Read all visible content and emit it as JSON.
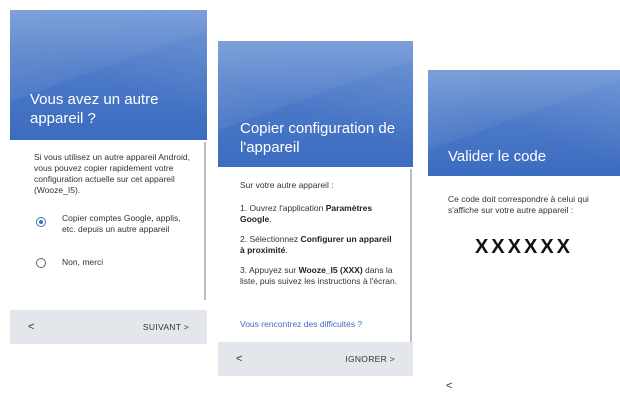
{
  "screen1": {
    "title": "Vous avez un autre appareil ?",
    "description": "Si vous utilisez un autre appareil Android, vous pouvez copier rapidement votre configuration actuelle sur cet appareil (Wooze_I5).",
    "options": [
      {
        "label": "Copier comptes Google, applis, etc. depuis un autre appareil",
        "selected": true
      },
      {
        "label": "Non, merci",
        "selected": false
      }
    ],
    "back_label": "<",
    "next_label": "SUIVANT >"
  },
  "screen2": {
    "title": "Copier configuration de l'appareil",
    "intro": "Sur votre autre appareil :",
    "step1_prefix": "1. Ouvrez l'application ",
    "step1_bold": "Paramètres Google",
    "step1_suffix": ".",
    "step2_prefix": "2. Sélectionnez ",
    "step2_bold": "Configurer un appareil à proximité",
    "step2_suffix": ".",
    "step3_prefix": "3. Appuyez sur ",
    "step3_bold": "Wooze_I5 (XXX)",
    "step3_suffix": " dans la liste, puis suivez les instructions à l'écran.",
    "help_link": "Vous rencontrez des difficultés ?",
    "back_label": "<",
    "skip_label": "IGNORER >"
  },
  "screen3": {
    "title": "Valider le code",
    "description": "Ce code doit correspondre à celui qui s'affiche sur votre autre appareil :",
    "code": "XXXXXX",
    "back_label": "<"
  },
  "colors": {
    "header_blue": "#3f6fbf",
    "footer_gray": "#e3e6ea",
    "link_blue": "#3f6fbf"
  }
}
